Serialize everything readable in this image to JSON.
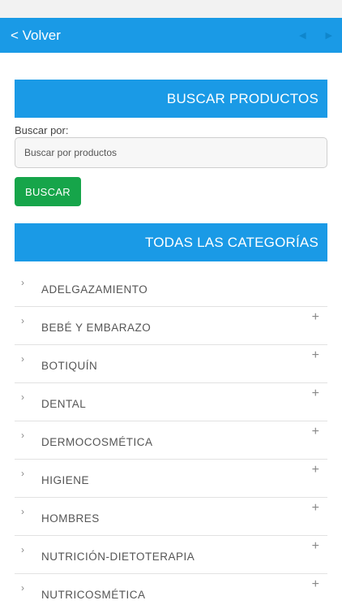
{
  "nav": {
    "back_label": "< Volver",
    "prev_icon": "◀",
    "next_icon": "▶"
  },
  "search": {
    "header": "BUSCAR PRODUCTOS",
    "label": "Buscar por:",
    "placeholder": "Buscar por productos",
    "button_label": "BUSCAR"
  },
  "categories": {
    "header": "TODAS LAS CATEGORÍAS",
    "items": [
      {
        "name": "ADELGAZAMIENTO",
        "expandable": false
      },
      {
        "name": "BEBÉ Y EMBARAZO",
        "expandable": true
      },
      {
        "name": "BOTIQUÍN",
        "expandable": true
      },
      {
        "name": "DENTAL",
        "expandable": true
      },
      {
        "name": "DERMOCOSMÉTICA",
        "expandable": true
      },
      {
        "name": "HIGIENE",
        "expandable": true
      },
      {
        "name": "HOMBRES",
        "expandable": true
      },
      {
        "name": "NUTRICIÓN-DIETOTERAPIA",
        "expandable": true
      },
      {
        "name": "NUTRICOSMÉTICA",
        "expandable": true
      }
    ],
    "chevron_icon": "›",
    "plus_icon": "+"
  },
  "colors": {
    "primary": "#1a9ae6",
    "button": "#16a54a"
  }
}
